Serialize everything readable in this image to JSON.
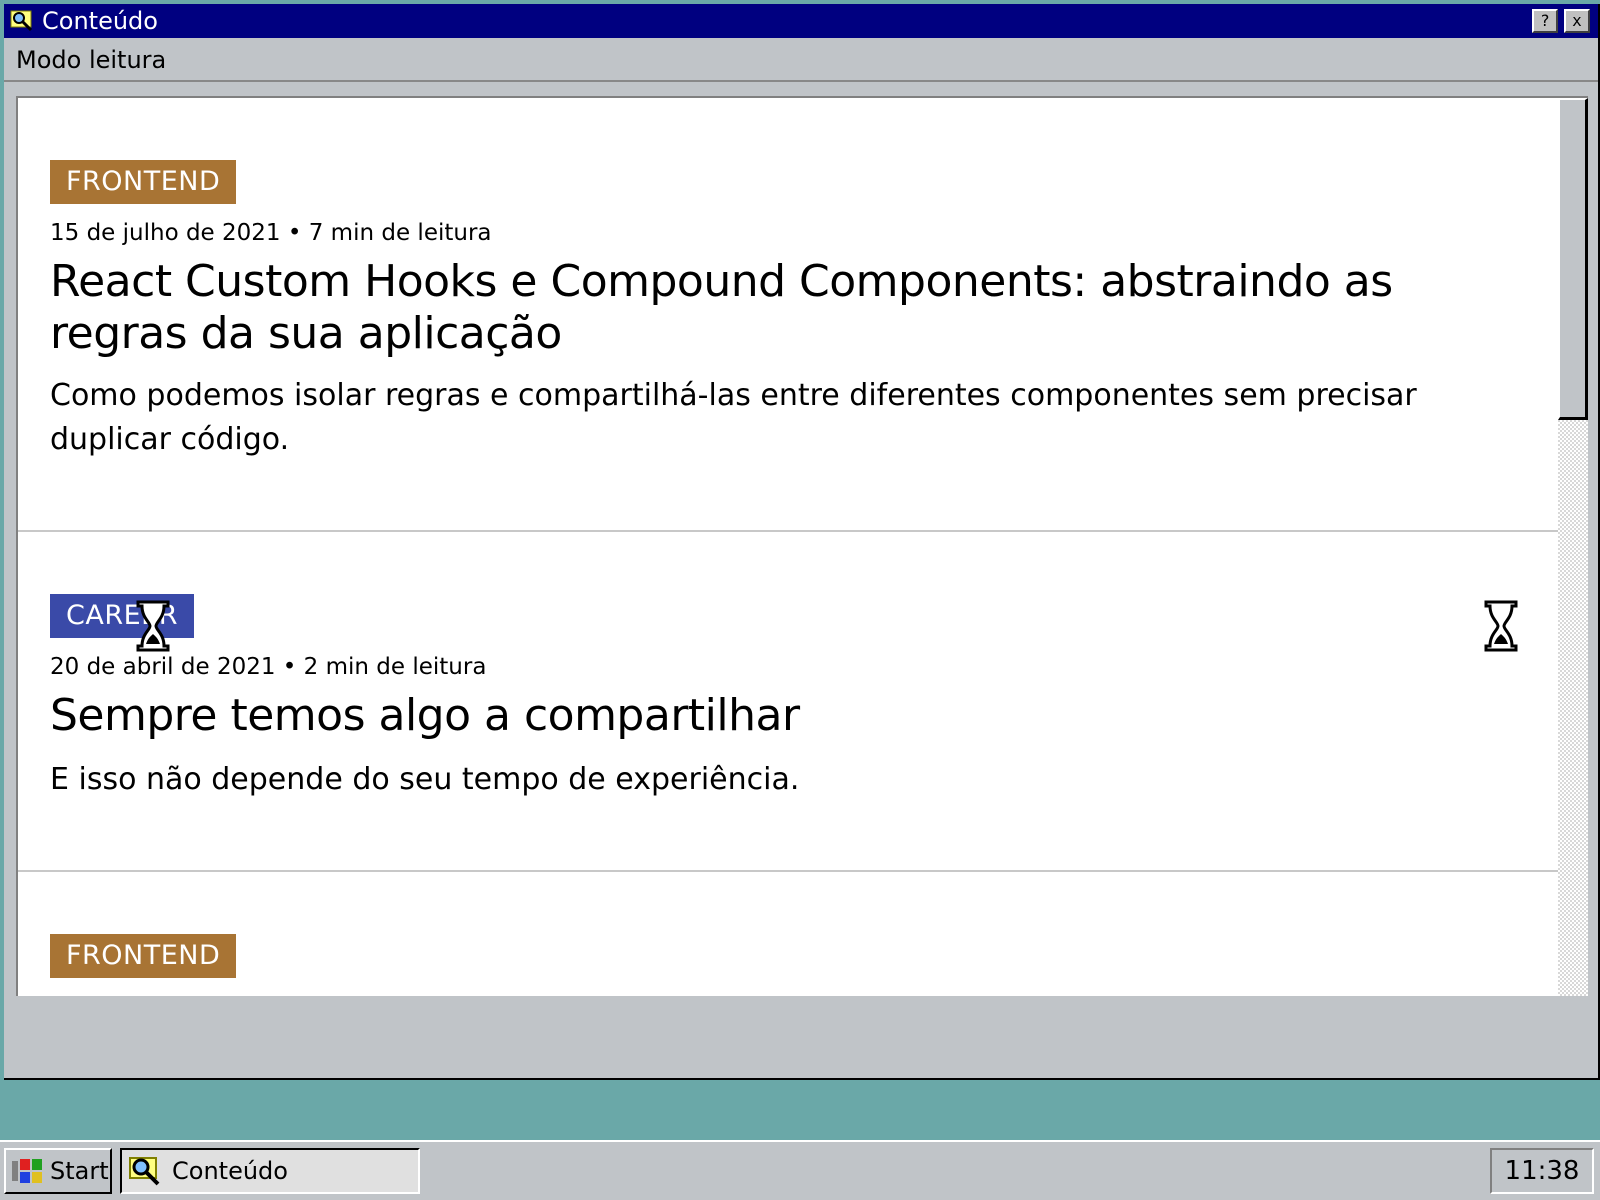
{
  "window": {
    "title": "Conteúdo",
    "help_button": "?",
    "close_button": "x"
  },
  "menu": {
    "items": [
      "Modo leitura"
    ]
  },
  "articles": [
    {
      "tag": "FRONTEND",
      "meta": "15 de julho de 2021 • 7 min de leitura",
      "title": "React Custom Hooks e Compound Components: abstraindo as regras da sua aplicação",
      "summary": "Como podemos isolar regras e compartilhá-las entre diferentes componentes sem precisar duplicar código."
    },
    {
      "tag": "CAREER",
      "meta": "20 de abril de 2021 • 2 min de leitura",
      "title": "Sempre temos algo a compartilhar",
      "summary": "E isso não depende do seu tempo de experiência."
    },
    {
      "tag": "FRONTEND"
    }
  ],
  "colors": {
    "titlebar": "#000080",
    "tag_frontend": "#a87434",
    "tag_career": "#3a4aa8",
    "desktop": "#6aa8a8"
  },
  "taskbar": {
    "start_label": "Start",
    "task_label": "Conteúdo",
    "clock": "11:38"
  }
}
